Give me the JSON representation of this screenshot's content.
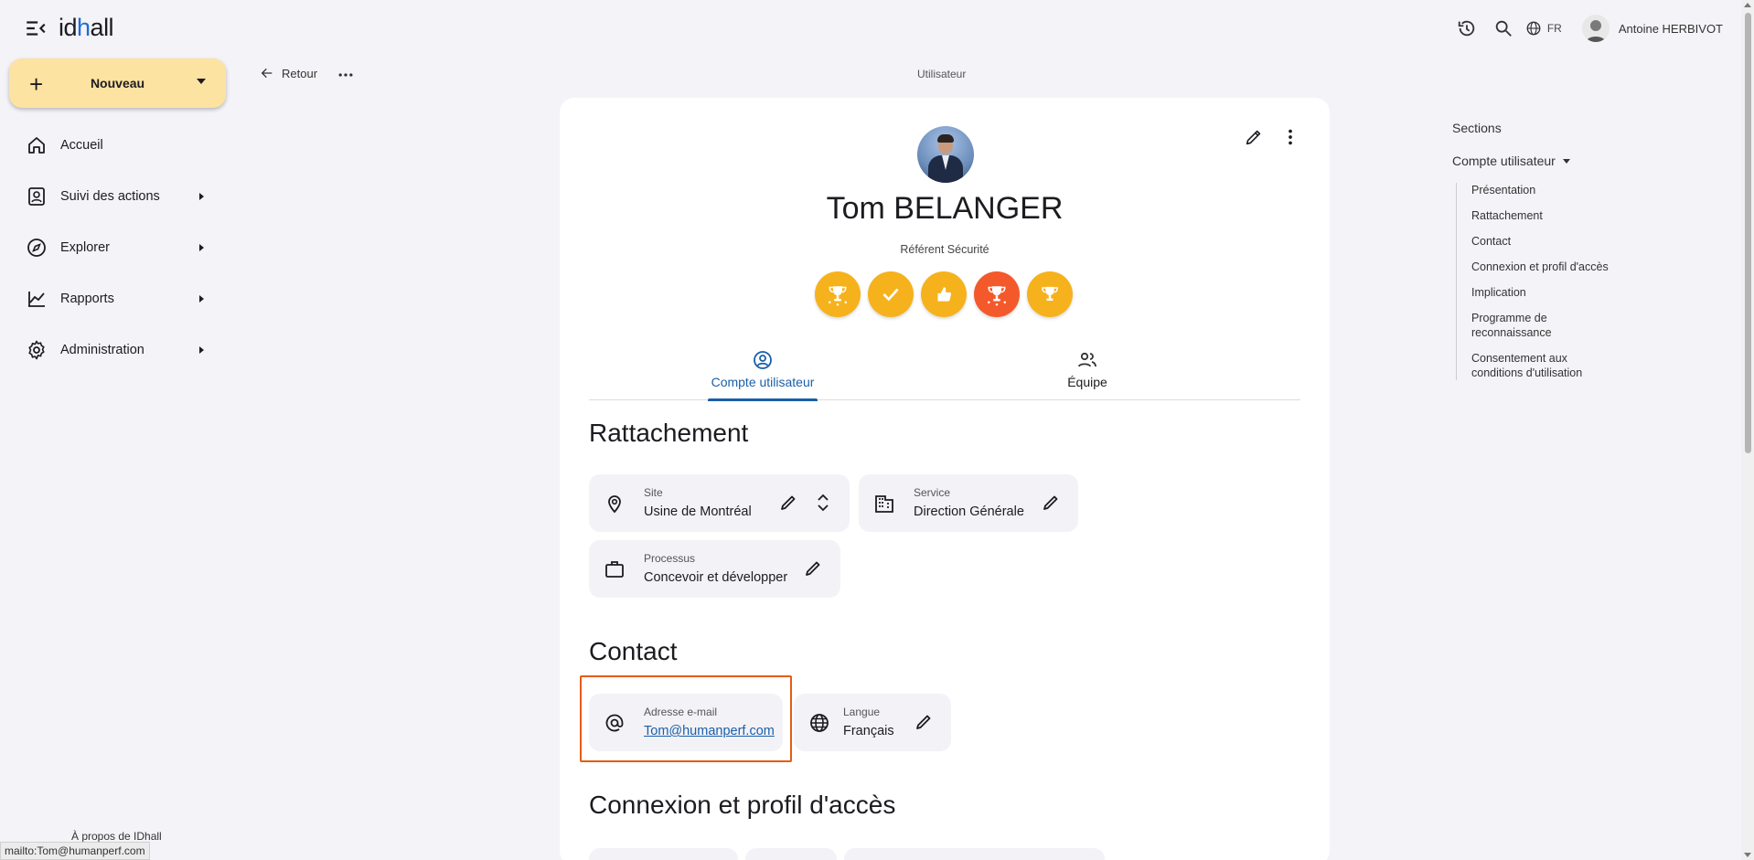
{
  "header": {
    "logo_prefix": "id",
    "logo_dot": "h",
    "logo_suffix": "all",
    "language": "FR",
    "user_name": "Antoine HERBIVOT"
  },
  "sidebar": {
    "new_button": "Nouveau",
    "items": [
      {
        "label": "Accueil",
        "icon": "home-icon"
      },
      {
        "label": "Suivi des actions",
        "icon": "clipboard-user-icon"
      },
      {
        "label": "Explorer",
        "icon": "compass-icon"
      },
      {
        "label": "Rapports",
        "icon": "chart-icon"
      },
      {
        "label": "Administration",
        "icon": "gear-icon"
      }
    ],
    "about": "À propos de IDhall"
  },
  "topbar": {
    "back": "Retour",
    "page_title": "Utilisateur"
  },
  "profile": {
    "name": "Tom BELANGER",
    "role": "Référent Sécurité",
    "badges": [
      {
        "icon": "trophy-stars-icon",
        "color": "#f6b21c"
      },
      {
        "icon": "check-icon",
        "color": "#f6b21c"
      },
      {
        "icon": "thumbs-up-icon",
        "color": "#f6b21c"
      },
      {
        "icon": "trophy-stars-icon",
        "color": "#f4592b"
      },
      {
        "icon": "trophy-icon",
        "color": "#f6b21c"
      }
    ]
  },
  "tabs": [
    {
      "label": "Compte utilisateur",
      "active": true
    },
    {
      "label": "Équipe",
      "active": false
    }
  ],
  "rattachement": {
    "title": "Rattachement",
    "site": {
      "label": "Site",
      "value": "Usine de Montréal"
    },
    "service": {
      "label": "Service",
      "value": "Direction Générale"
    },
    "processus": {
      "label": "Processus",
      "value": "Concevoir et développer"
    }
  },
  "contact": {
    "title": "Contact",
    "email": {
      "label": "Adresse e-mail",
      "value": "Tom@humanperf.com"
    },
    "langue": {
      "label": "Langue",
      "value": "Français"
    }
  },
  "connexion": {
    "title": "Connexion et profil d'accès"
  },
  "sections": {
    "title": "Sections",
    "selected": "Compte utilisateur",
    "items": [
      "Présentation",
      "Rattachement",
      "Contact",
      "Connexion et profil d'accès",
      "Implication",
      "Programme de reconnaissance",
      "Consentement aux conditions d'utilisation"
    ]
  },
  "status_bar": "mailto:Tom@humanperf.com",
  "colors": {
    "accent": "#1a5fa8",
    "new_button": "#fde3a1",
    "highlight": "#e65c12"
  }
}
